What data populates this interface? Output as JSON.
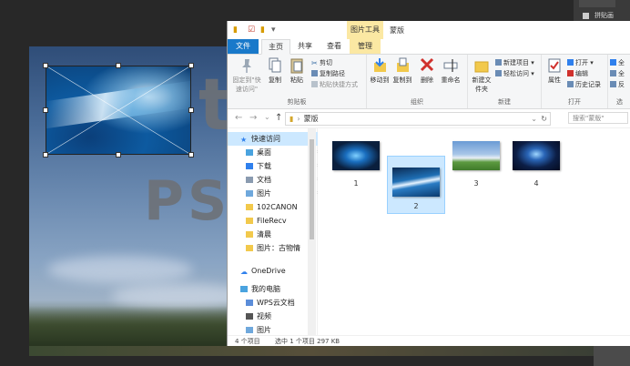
{
  "explorer": {
    "title": "蒙版",
    "context_tab": "图片工具",
    "tabs": [
      "文件",
      "主页",
      "共享",
      "查看",
      "管理"
    ],
    "ribbon": {
      "pin_label": "固定到\"快速访问\"",
      "copy_label": "复制",
      "paste_label": "粘贴",
      "cut_label": "剪切",
      "copy_path_label": "复制路径",
      "paste_shortcut_label": "粘贴快捷方式",
      "clipboard_group": "剪贴板",
      "move_to_label": "移动到",
      "copy_to_label": "复制到",
      "delete_label": "删除",
      "rename_label": "重命名",
      "organize_group": "组织",
      "new_folder_label": "新建文件夹",
      "new_item_label": "新建项目",
      "easy_access_label": "轻松访问",
      "new_group": "新建",
      "properties_label": "属性",
      "open_label": "打开",
      "edit_label": "编辑",
      "history_label": "历史记录",
      "open_group": "打开",
      "select_all_label": "全",
      "select_none_label": "全",
      "invert_label": "反",
      "select_group": "选"
    },
    "address": {
      "path": "蒙版",
      "search_placeholder": "搜索\"蒙版\""
    },
    "nav": [
      {
        "label": "快速访问",
        "pinned": false
      },
      {
        "label": "桌面",
        "pinned": true
      },
      {
        "label": "下载",
        "pinned": true
      },
      {
        "label": "文档",
        "pinned": true
      },
      {
        "label": "图片",
        "pinned": true
      },
      {
        "label": "102CANON",
        "pinned": false
      },
      {
        "label": "FileRecv",
        "pinned": false
      },
      {
        "label": "清晨",
        "pinned": false
      },
      {
        "label": "图片：古物情",
        "pinned": false
      },
      {
        "label": "OneDrive",
        "pinned": false
      },
      {
        "label": "我的电脑",
        "pinned": false
      },
      {
        "label": "WPS云文档",
        "pinned": false
      },
      {
        "label": "视频",
        "pinned": false
      },
      {
        "label": "图片",
        "pinned": false
      }
    ],
    "files": [
      {
        "name": "1",
        "selected": false
      },
      {
        "name": "2",
        "selected": true
      },
      {
        "name": "3",
        "selected": false
      },
      {
        "name": "4",
        "selected": false
      }
    ],
    "status": {
      "count": "4 个项目",
      "selection": "选中 1 个项目 297 KB"
    }
  },
  "photoshop": {
    "panel_item": "拼贴画",
    "canvas_text_1": "t",
    "canvas_text_2": "PS"
  },
  "colors": {
    "accent": "#1979ca",
    "selection": "#cce8ff",
    "context_tab": "#fbe8a3"
  }
}
